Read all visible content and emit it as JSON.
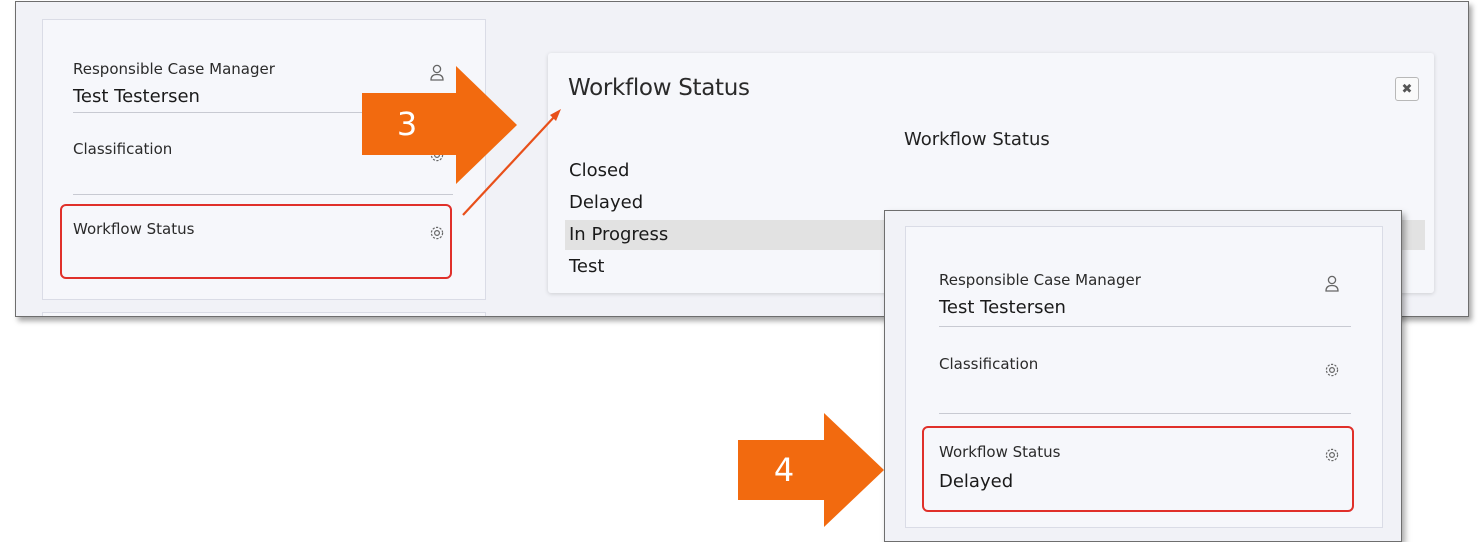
{
  "screen1": {
    "panel": {
      "manager_label": "Responsible Case Manager",
      "manager_value": "Test Testersen",
      "classification_label": "Classification",
      "workflow_label": "Workflow Status"
    },
    "dialog": {
      "title": "Workflow Status",
      "close_icon": "close-icon",
      "heading": "Workflow Status",
      "options": [
        "Closed",
        "Delayed",
        "In Progress",
        "Test"
      ],
      "selected_option": "In Progress"
    }
  },
  "screen2": {
    "panel": {
      "manager_label": "Responsible Case Manager",
      "manager_value": "Test Testersen",
      "classification_label": "Classification",
      "workflow_label": "Workflow Status",
      "workflow_value": "Delayed"
    }
  },
  "callouts": {
    "step3": "3",
    "step4": "4",
    "color": "#f26a0f"
  },
  "colors": {
    "highlight": "#e0302a",
    "background": "#f1f2f7",
    "panel": "#f6f7fb"
  },
  "icons": [
    "user-icon",
    "gear-icon",
    "close-icon",
    "arrow-right-icon"
  ]
}
